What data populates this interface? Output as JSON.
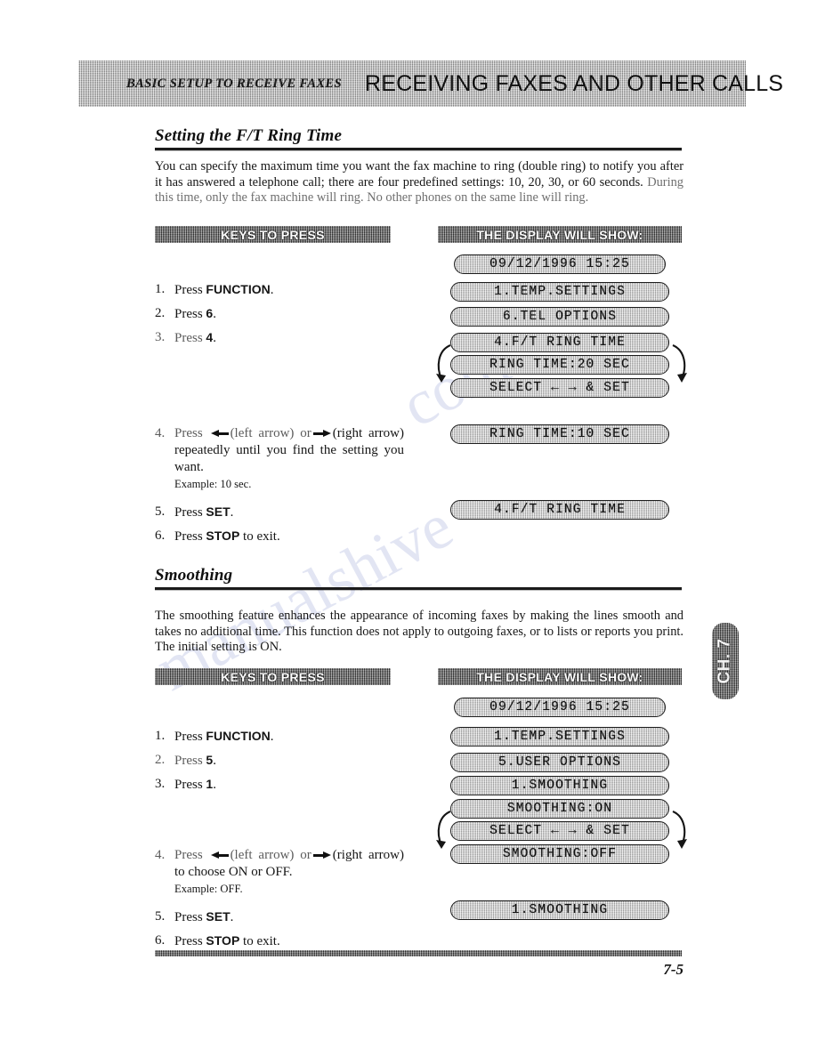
{
  "header": {
    "chapter_label": "BASIC SETUP TO RECEIVE FAXES",
    "section_title": "RECEIVING FAXES AND OTHER CALLS"
  },
  "chapter_tab": "CH. 7",
  "watermark": {
    "line1": "manualshive",
    "line2": "com"
  },
  "column_headers": {
    "keys": "KEYS TO PRESS",
    "display": "THE DISPLAY WILL SHOW:"
  },
  "sections": [
    {
      "heading": "Setting the F/T Ring Time",
      "body": "You can specify the maximum time you want the fax machine to ring (double ring) to notify you after it has answered a telephone call; there are four predefined settings: 10, 20, 30, or 60 seconds.",
      "body_faded": "During this time, only the fax machine will ring. No other phones on the same line will ring.",
      "steps": [
        {
          "num": "1.",
          "text": "Press ",
          "bold": "FUNCTION",
          "tail": "."
        },
        {
          "num": "2.",
          "text": "Press ",
          "bold": "6",
          "tail": "."
        },
        {
          "num": "3.",
          "text": "Press ",
          "bold": "4",
          "tail": "."
        },
        {
          "num": "4.",
          "pre": "Press ",
          "left_paren": "(left arrow) or",
          "right_paren": "(right arrow) repeatedly until you find the setting you want.",
          "example": "Example: 10 sec."
        },
        {
          "num": "5.",
          "text": "Press ",
          "bold": "SET",
          "tail": "."
        },
        {
          "num": "6.",
          "text": "Press ",
          "bold": "STOP",
          "tail": " to exit."
        }
      ],
      "displays": [
        {
          "text": "09/12/1996 15:25"
        },
        {
          "text": "1.TEMP.SETTINGS"
        },
        {
          "text": "6.TEL OPTIONS"
        },
        {
          "text": "4.F/T RING TIME"
        },
        {
          "text": "RING TIME:20 SEC"
        },
        {
          "text": "SELECT ← → & SET"
        },
        {
          "text": "RING TIME:10 SEC"
        },
        {
          "text": "4.F/T RING TIME"
        }
      ]
    },
    {
      "heading": "Smoothing",
      "body": "The smoothing feature enhances the appearance of incoming faxes by making the lines smooth and takes no additional time. This function does not apply to outgoing faxes, or to lists or reports you print. The initial setting is ON.",
      "steps": [
        {
          "num": "1.",
          "text": "Press ",
          "bold": "FUNCTION",
          "tail": "."
        },
        {
          "num": "2.",
          "text": "Press ",
          "bold": "5",
          "tail": "."
        },
        {
          "num": "3.",
          "text": "Press ",
          "bold": "1",
          "tail": "."
        },
        {
          "num": "4.",
          "pre": "Press ",
          "left_paren": "(left arrow) or",
          "right_paren": "(right arrow) to choose ON or OFF.",
          "example": "Example: OFF."
        },
        {
          "num": "5.",
          "text": "Press ",
          "bold": "SET",
          "tail": "."
        },
        {
          "num": "6.",
          "text": "Press ",
          "bold": "STOP",
          "tail": " to exit."
        }
      ],
      "displays": [
        {
          "text": "09/12/1996 15:25"
        },
        {
          "text": "1.TEMP.SETTINGS"
        },
        {
          "text": "5.USER OPTIONS"
        },
        {
          "text": "1.SMOOTHING"
        },
        {
          "text": "SMOOTHING:ON"
        },
        {
          "text": "SELECT ← → & SET"
        },
        {
          "text": "SMOOTHING:OFF"
        },
        {
          "text": "1.SMOOTHING"
        }
      ]
    }
  ],
  "footer": {
    "page_number": "7-5"
  }
}
